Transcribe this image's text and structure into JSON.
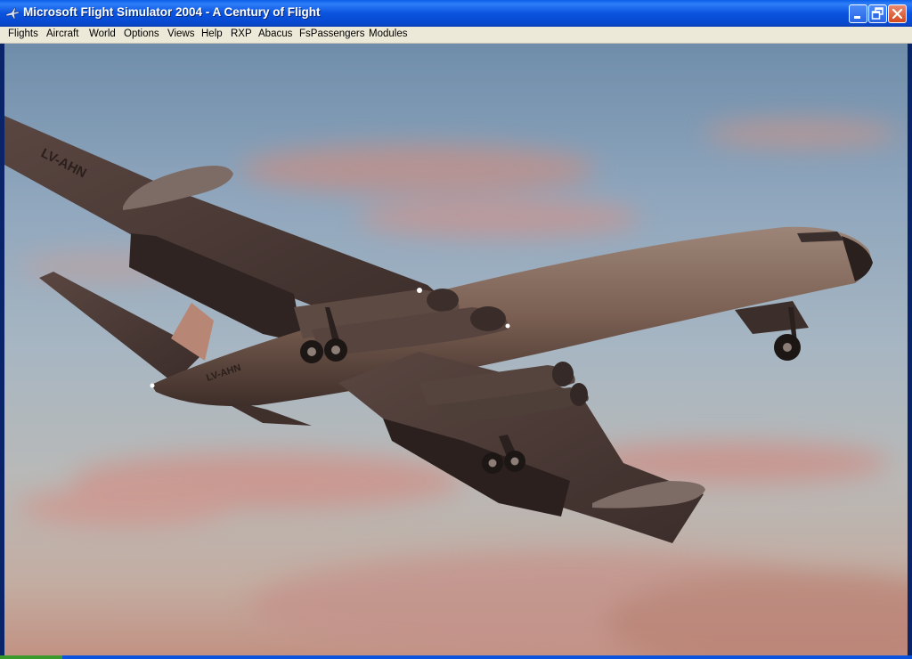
{
  "window": {
    "title": "Microsoft Flight Simulator 2004 - A Century of Flight",
    "app_icon": "airplane-icon",
    "caption_buttons": [
      "minimize-icon",
      "restore-icon",
      "close-icon"
    ]
  },
  "menu": {
    "items": [
      "Flights",
      "Aircraft",
      "World",
      "Options",
      "Views",
      "Help",
      "RXP",
      "Abacus",
      "FsPassengers",
      "Modules"
    ]
  },
  "scene": {
    "registration_wing": "LV-AHN",
    "registration_fuselage": "LV-AHN"
  },
  "colors": {
    "titlebar": "#0a53df",
    "menubar": "#ece9d8",
    "sky_top": "#6f8daa",
    "sky_bottom": "#c29283",
    "aircraft_body": "#6b5348"
  }
}
